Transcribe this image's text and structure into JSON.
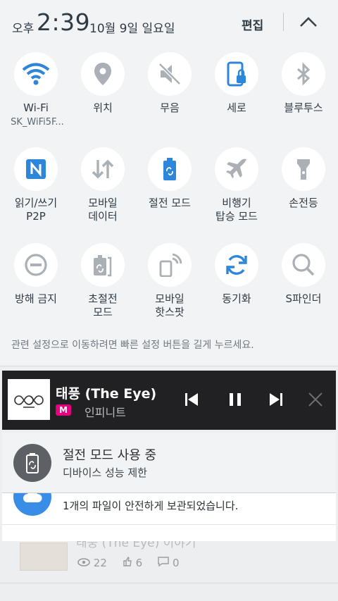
{
  "status": {
    "ampm": "오후",
    "time": "2:39",
    "date": "10월 9일 일요일",
    "edit_label": "편집"
  },
  "tiles": [
    {
      "label": "Wi-Fi",
      "sub": "SK_WiFi5F...",
      "icon": "wifi-icon",
      "active": true
    },
    {
      "label": "위치",
      "icon": "location-icon",
      "active": false
    },
    {
      "label": "무음",
      "icon": "mute-icon",
      "active": false
    },
    {
      "label": "세로",
      "icon": "portrait-lock-icon",
      "active": true
    },
    {
      "label": "블루투스",
      "icon": "bluetooth-icon",
      "active": false
    },
    {
      "label": "읽기/쓰기\nP2P",
      "icon": "nfc-icon",
      "active": true
    },
    {
      "label": "모바일\n데이터",
      "icon": "mobile-data-icon",
      "active": false
    },
    {
      "label": "절전 모드",
      "icon": "power-saving-icon",
      "active": true
    },
    {
      "label": "비행기\n탑승 모드",
      "icon": "airplane-icon",
      "active": false
    },
    {
      "label": "손전등",
      "icon": "flashlight-icon",
      "active": false
    },
    {
      "label": "방해 금지",
      "icon": "do-not-disturb-icon",
      "active": false
    },
    {
      "label": "초절전\n모드",
      "icon": "ultra-power-saving-icon",
      "active": false
    },
    {
      "label": "모바일\n핫스팟",
      "icon": "hotspot-icon",
      "active": false
    },
    {
      "label": "동기화",
      "icon": "sync-icon",
      "active": true
    },
    {
      "label": "S파인더",
      "icon": "s-finder-icon",
      "active": false
    }
  ],
  "hint": "관련 설정으로 이동하려면 빠른 설정 버튼을 길게 누르세요.",
  "media": {
    "song": "태풍 (The Eye)",
    "app_logo": "M",
    "artist": "인피니트"
  },
  "notifications": {
    "power_title": "절전 모드 사용 중",
    "power_sub": "디바이스 성능 제한",
    "cloud_text": "1개의 파일이 안전하게 보관되었습니다."
  },
  "background": {
    "post_title": "태풍 (The Eye) 이야기",
    "views": "22",
    "likes": "6",
    "comments": "0"
  },
  "colors": {
    "active_icon": "#2d86d9",
    "inactive_icon": "#aab0b6",
    "panel_bg": "#f2f3f5",
    "media_bg": "#212123"
  }
}
